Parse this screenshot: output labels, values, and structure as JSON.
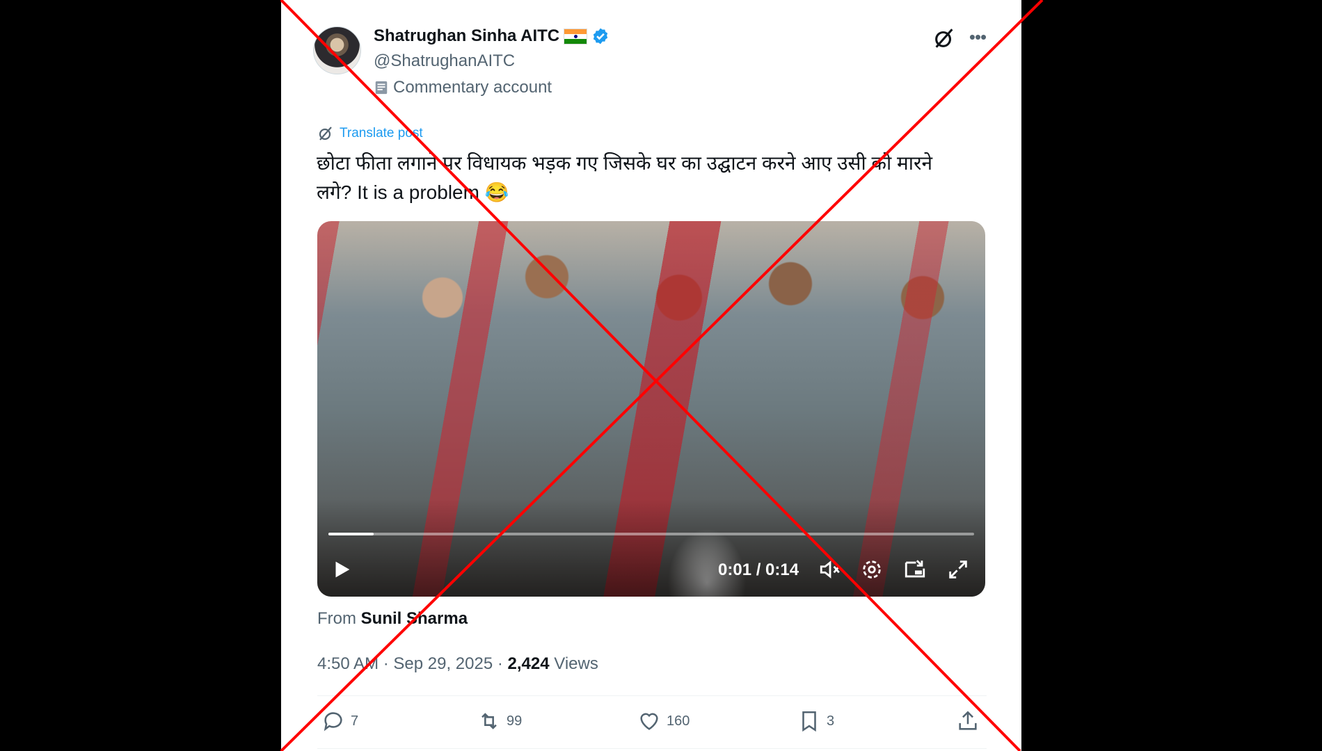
{
  "author": {
    "name": "Shatrughan Sinha AITC",
    "handle": "@ShatrughanAITC",
    "label": "Commentary account",
    "flag_colors": [
      "#ff9933",
      "#ffffff",
      "#138808"
    ],
    "verified_color": "#1d9bf0"
  },
  "post": {
    "translate_label": "Translate post",
    "text": "छोटा फीता लगाने पर विधायक भड़क गए जिसके घर का उद्घाटन करने आए उसी को मारने लगे? It is a problem 😂",
    "from_label": "From",
    "from_name": "Sunil Sharma",
    "timestamp": "4:50 AM · Sep 29, 2025 ·",
    "views_count": "2,424",
    "views_label": "Views"
  },
  "video": {
    "time": "0:01 / 0:14",
    "progress": 0.07
  },
  "actions": {
    "replies": "7",
    "reposts": "99",
    "likes": "160",
    "bookmarks": "3"
  },
  "icons": [
    "grok-icon",
    "more-icon",
    "verified-icon",
    "play-icon",
    "mute-icon",
    "settings-icon",
    "pip-icon",
    "fullscreen-icon",
    "reply-icon",
    "repost-icon",
    "like-icon",
    "bookmark-icon",
    "share-icon"
  ],
  "overlay": {
    "cross_color": "#ff0000"
  }
}
